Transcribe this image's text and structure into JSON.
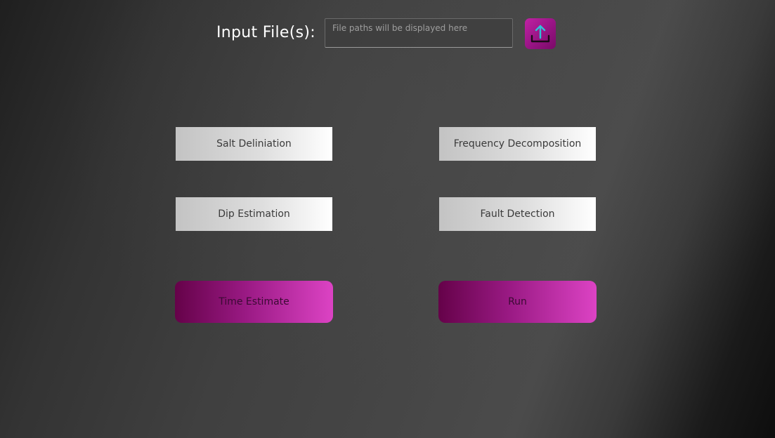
{
  "input": {
    "label": "Input File(s):",
    "placeholder": "File paths will be displayed here",
    "value": ""
  },
  "upload": {
    "icon": "upload-icon",
    "icon_color": "#2ec4d6",
    "button_color": "#b01d98"
  },
  "tools": {
    "salt": "Salt Deliniation",
    "frequency": "Frequency Decomposition",
    "dip": "Dip Estimation",
    "fault": "Fault Detection"
  },
  "actions": {
    "time_estimate": "Time Estimate",
    "run": "Run"
  },
  "colors": {
    "accent_magenta": "#dc43c4",
    "accent_dark": "#650249"
  }
}
